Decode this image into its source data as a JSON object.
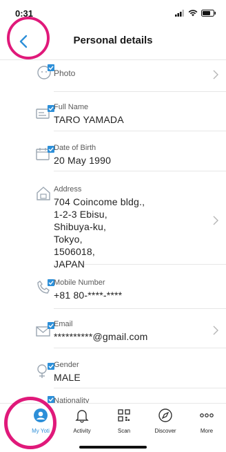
{
  "status": {
    "time": "0:31"
  },
  "header": {
    "title": "Personal details"
  },
  "rows": [
    {
      "label": "Photo",
      "value": ""
    },
    {
      "label": "Full Name",
      "value": "TARO YAMADA"
    },
    {
      "label": "Date of Birth",
      "value": "20 May 1990"
    },
    {
      "label": "Address",
      "value": "704 Coincome bldg.,\n1-2-3 Ebisu,\nShibuya-ku,\nTokyo,\n1506018,\nJAPAN"
    },
    {
      "label": "Mobile Number",
      "value": "+81 80-****-****"
    },
    {
      "label": "Email",
      "value": "**********@gmail.com"
    },
    {
      "label": "Gender",
      "value": "MALE"
    },
    {
      "label": "Nationality",
      "value": ""
    }
  ],
  "tabs": [
    {
      "label": "My Yoti"
    },
    {
      "label": "Activity"
    },
    {
      "label": "Scan"
    },
    {
      "label": "Discover"
    },
    {
      "label": "More"
    }
  ],
  "colors": {
    "accent": "#2d8fd8",
    "ring": "#e0197a",
    "icon": "#9aa5b1"
  }
}
